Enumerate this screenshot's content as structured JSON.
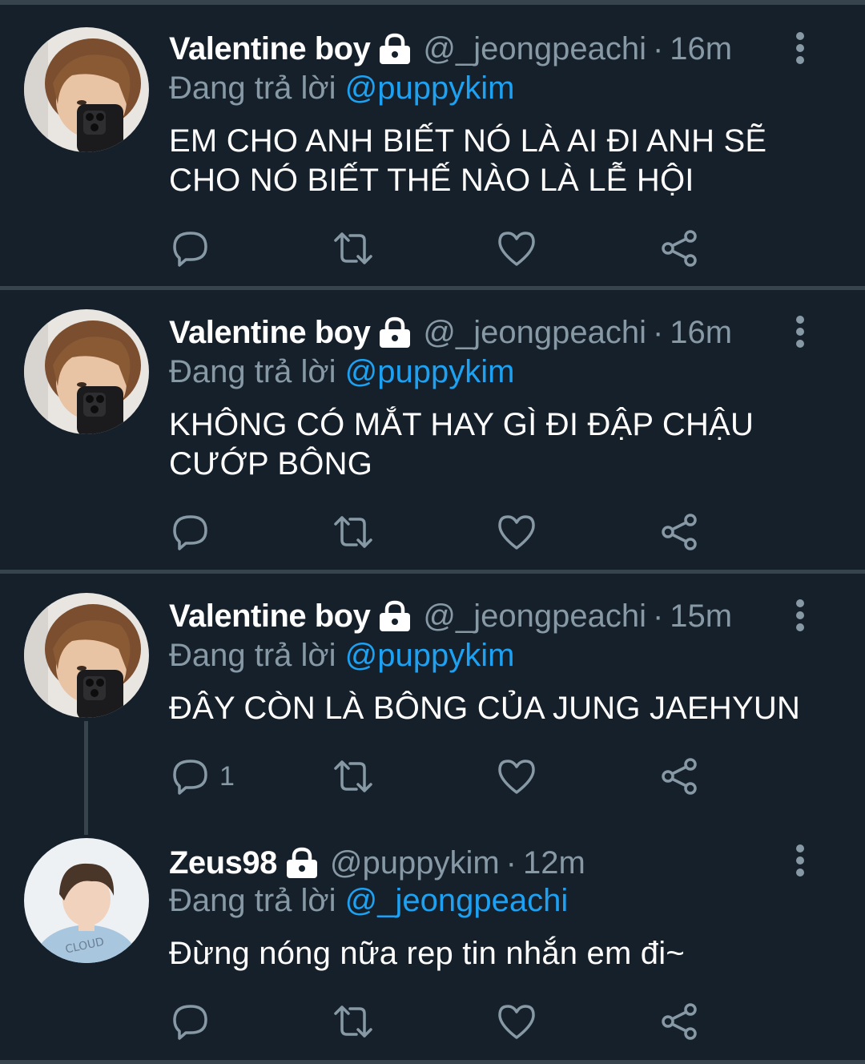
{
  "tweets": [
    {
      "name": "Valentine boy",
      "handle": "@_jeongpeachi",
      "separator": "·",
      "time": "16m",
      "reply_prefix": "Đang trả lời",
      "reply_to": "@puppykim",
      "text": "EM CHO ANH BIẾT NÓ LÀ AI ĐI ANH SẼ CHO NÓ BIẾT THẾ NÀO LÀ LỄ HỘI",
      "reply_count": ""
    },
    {
      "name": "Valentine boy",
      "handle": "@_jeongpeachi",
      "separator": "·",
      "time": "16m",
      "reply_prefix": "Đang trả lời",
      "reply_to": "@puppykim",
      "text": "KHÔNG CÓ MẮT HAY GÌ ĐI ĐẬP CHẬU CƯỚP BÔNG",
      "reply_count": ""
    },
    {
      "name": "Valentine boy",
      "handle": "@_jeongpeachi",
      "separator": "·",
      "time": "15m",
      "reply_prefix": "Đang trả lời",
      "reply_to": "@puppykim",
      "text": "ĐÂY CÒN LÀ BÔNG CỦA JUNG JAEHYUN",
      "reply_count": "1"
    },
    {
      "name": "Zeus98",
      "handle": "@puppykim",
      "separator": "·",
      "time": "12m",
      "reply_prefix": "Đang trả lời",
      "reply_to": "@_jeongpeachi",
      "text": "Đừng nóng nữa rep tin nhắn em đi~",
      "reply_count": ""
    }
  ],
  "icons": {
    "reply": "reply-icon",
    "retweet": "retweet-icon",
    "like": "like-icon",
    "share": "share-icon",
    "lock": "lock-icon",
    "more": "more-icon"
  },
  "colors": {
    "background": "#15202b",
    "divider": "#38444d",
    "secondary_text": "#8899a6",
    "mention": "#1da1f2"
  }
}
